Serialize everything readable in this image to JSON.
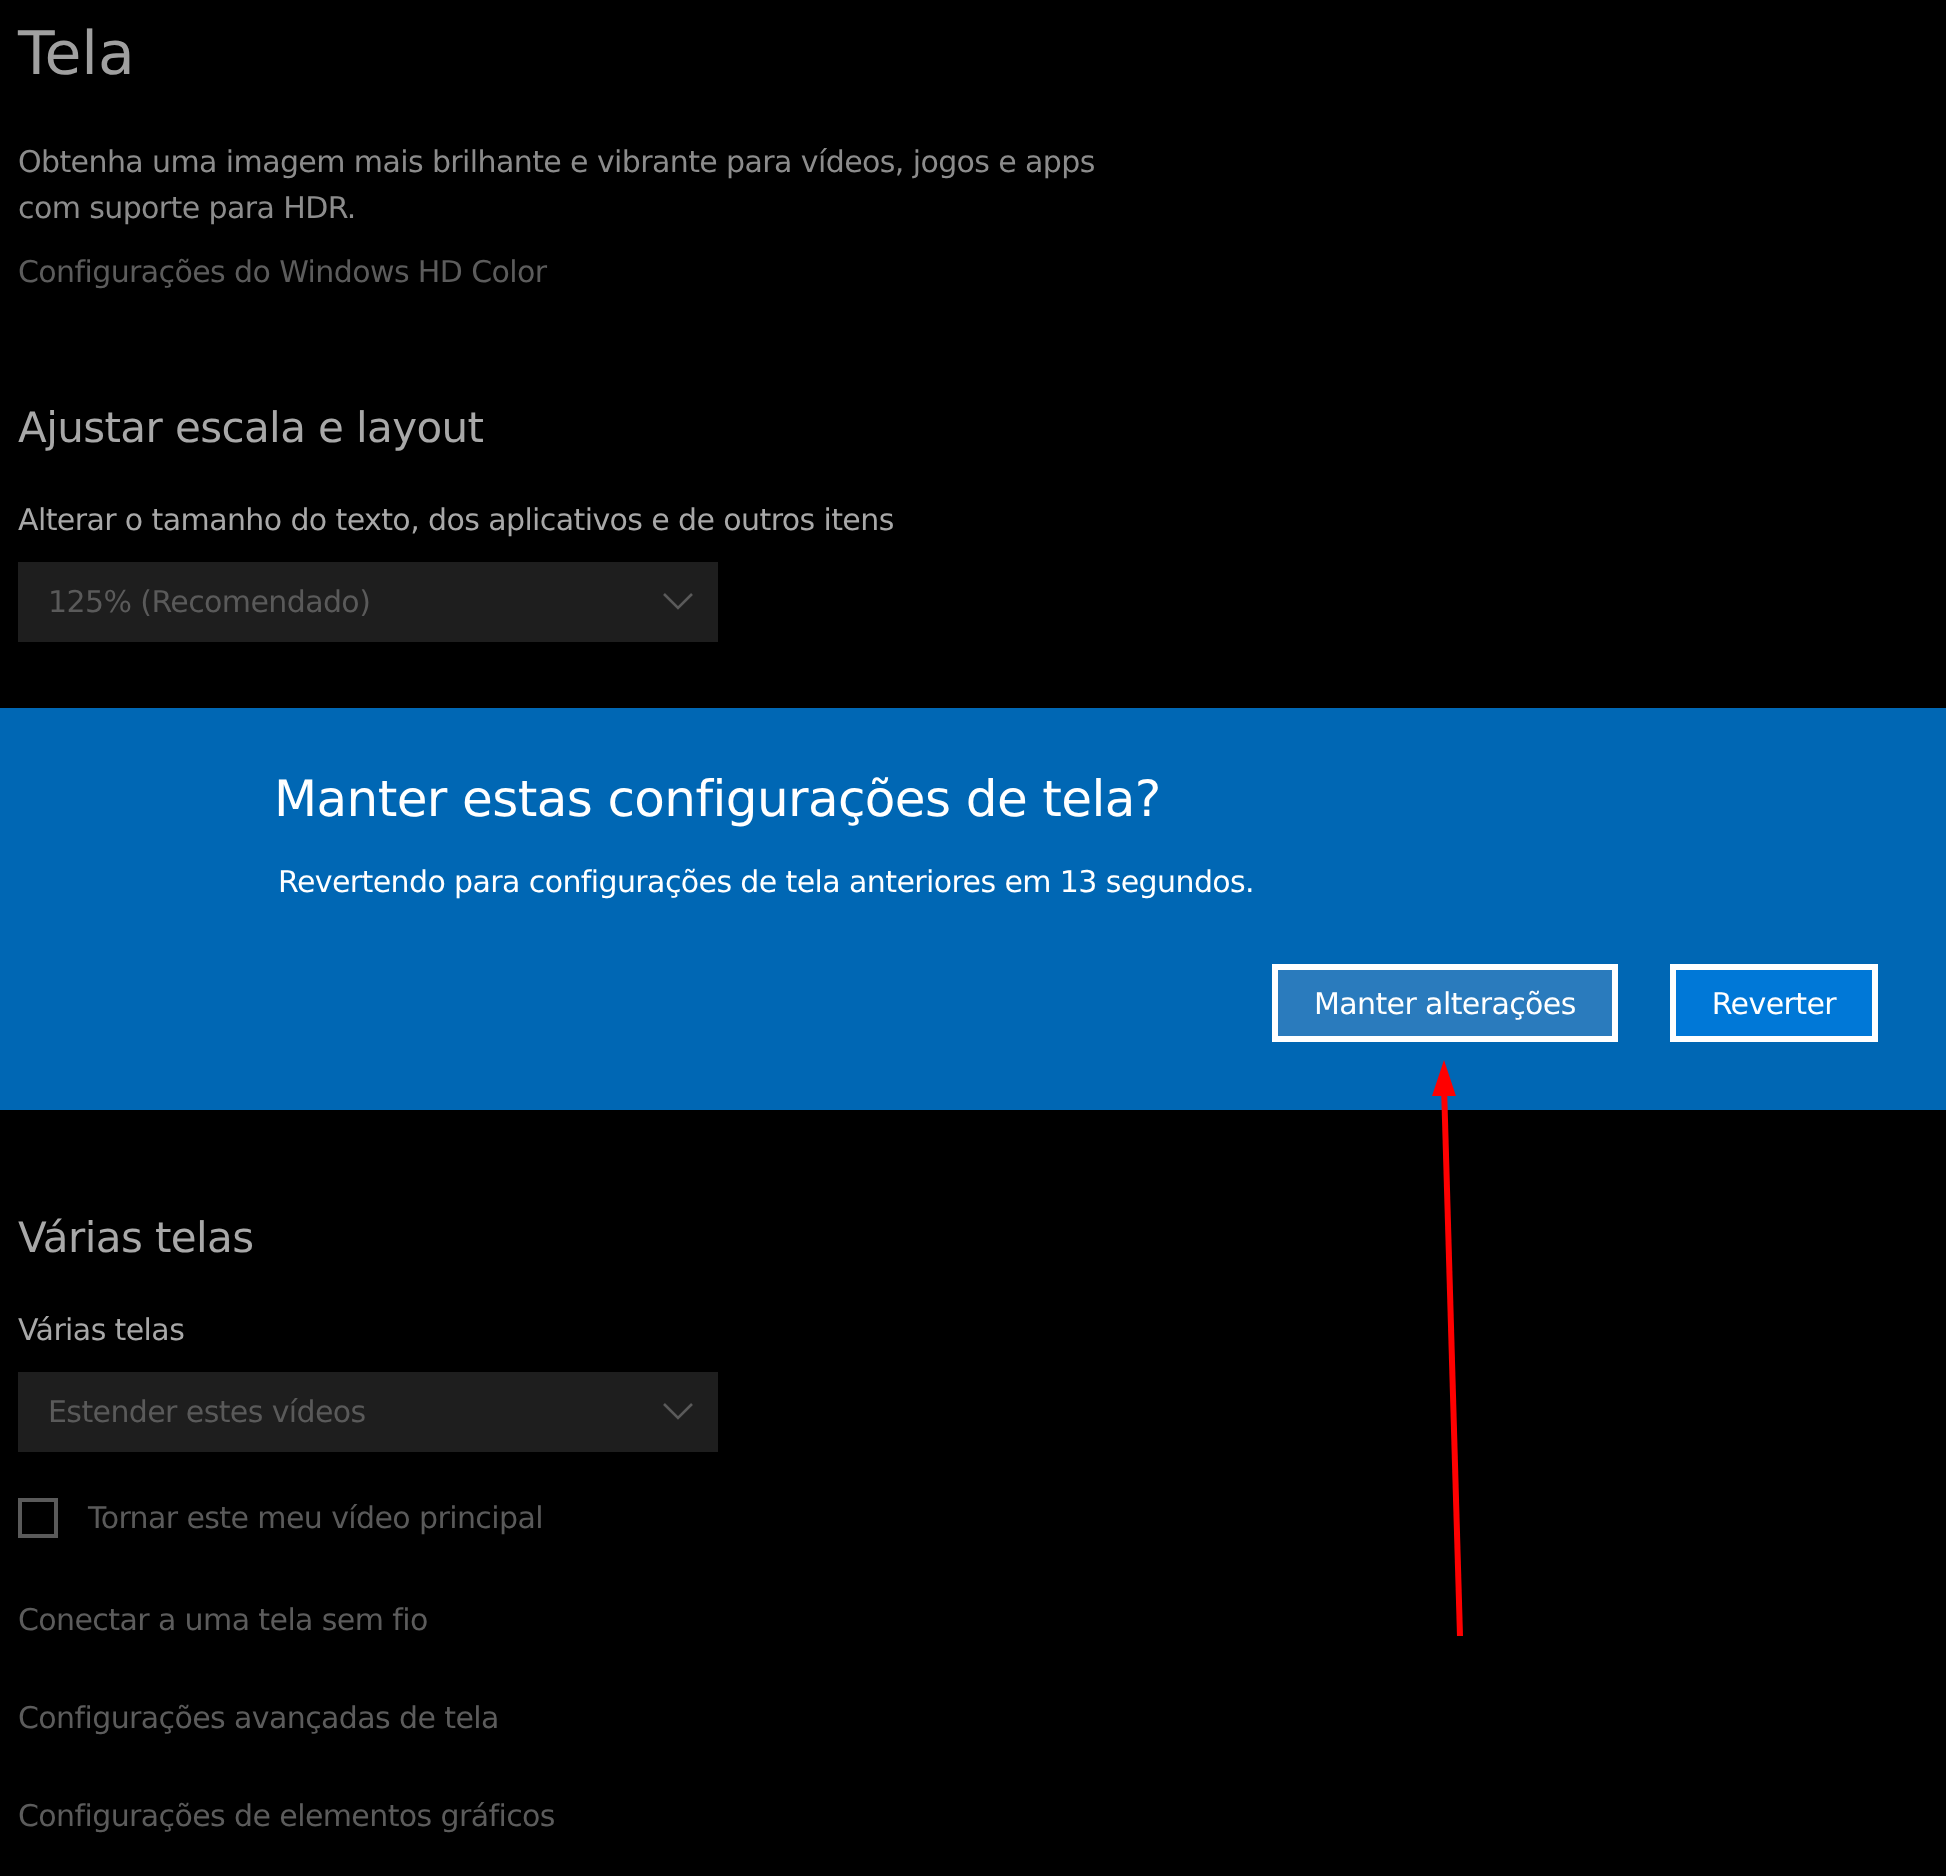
{
  "page": {
    "title": "Tela",
    "hdr_description": "Obtenha uma imagem mais brilhante e vibrante para vídeos, jogos e apps com suporte para HDR.",
    "hdr_link": "Configurações do Windows HD Color",
    "scale_section": {
      "heading": "Ajustar escala e layout",
      "label": "Alterar o tamanho do texto, dos aplicativos e de outros itens",
      "dropdown": "125% (Recomendado)"
    },
    "multi_section": {
      "heading": "Várias telas",
      "label": "Várias telas",
      "dropdown": "Estender estes vídeos",
      "checkbox": {
        "label": "Tornar este meu vídeo principal",
        "checked": false
      }
    },
    "links": [
      "Conectar a uma tela sem fio",
      "Configurações avançadas de tela",
      "Configurações de elementos gráficos"
    ]
  },
  "dialog": {
    "title": "Manter estas configurações de tela?",
    "message": "Revertendo para configurações de tela anteriores em 13 segundos.",
    "buttons": [
      {
        "label": "Manter alterações",
        "focused": true
      },
      {
        "label": "Reverter",
        "focused": false
      }
    ]
  }
}
